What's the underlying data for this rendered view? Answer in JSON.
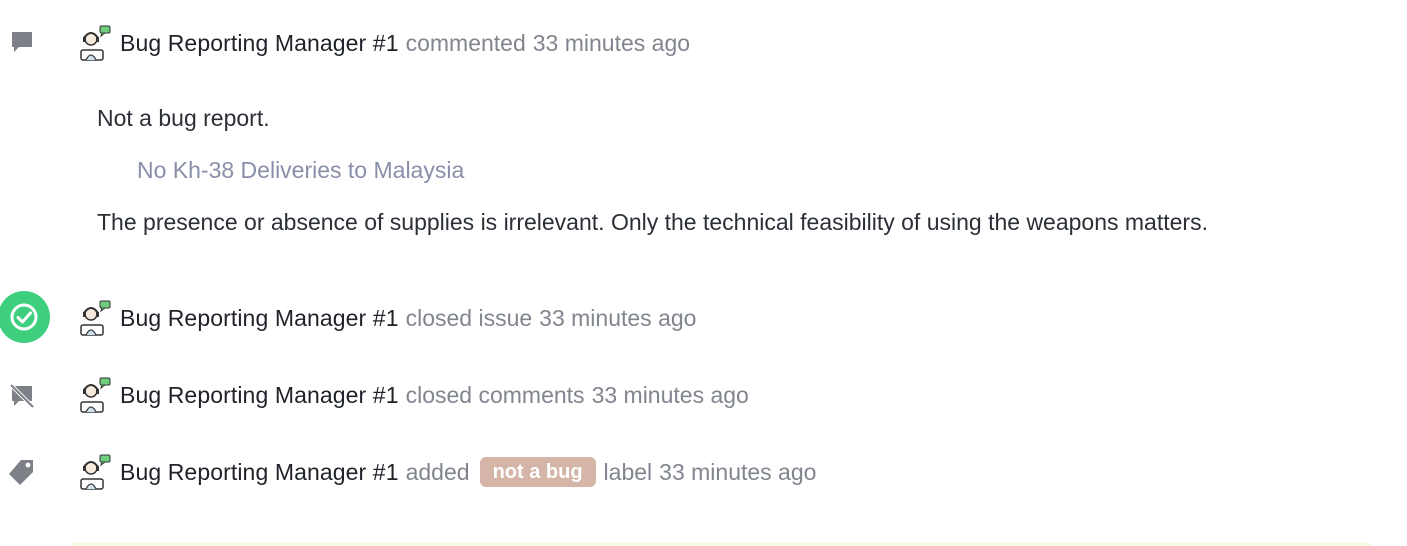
{
  "events": [
    {
      "type": "comment",
      "icon": "comment-icon",
      "author": "Bug Reporting Manager #1",
      "action": "commented",
      "time": "33 minutes ago",
      "body": {
        "intro": "Not a bug report.",
        "quote": "No Kh-38 Deliveries to Malaysia",
        "text": "The presence or absence of supplies is irrelevant. Only the technical feasibility of using the weapons matters."
      }
    },
    {
      "type": "closed",
      "icon": "check-circle-icon",
      "author": "Bug Reporting Manager #1",
      "action": "closed issue",
      "time": "33 minutes ago",
      "color": "#3ecf7e"
    },
    {
      "type": "locked",
      "icon": "comment-off-icon",
      "author": "Bug Reporting Manager #1",
      "action": "closed comments",
      "time": "33 minutes ago"
    },
    {
      "type": "labeled",
      "icon": "tag-icon",
      "author": "Bug Reporting Manager #1",
      "action": "added",
      "label": "not a bug",
      "label_color": "#d4b5a8",
      "label_suffix": "label",
      "time": "33 minutes ago"
    }
  ]
}
